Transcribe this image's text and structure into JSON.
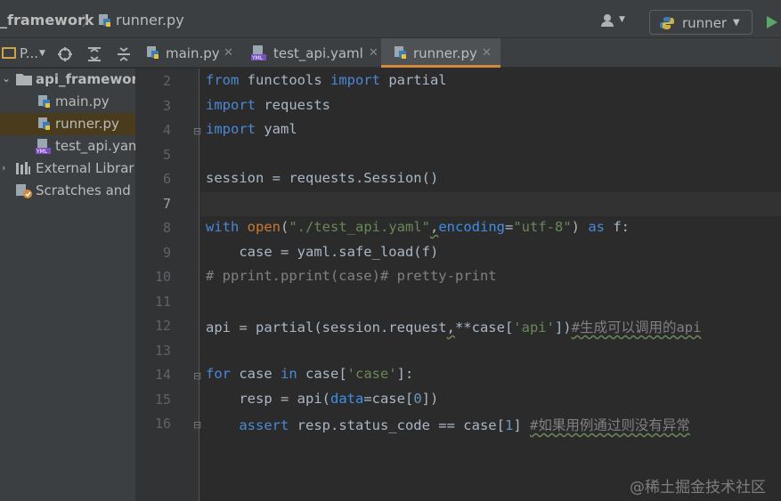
{
  "navbar": {
    "project_crumb": "_framework",
    "file_crumb": "runner.py",
    "run_config_label": "runner"
  },
  "toolstrip": {
    "project_label": "P..."
  },
  "tabs": [
    {
      "label": "main.py",
      "icon": "python-file-icon"
    },
    {
      "label": "test_api.yaml",
      "icon": "yaml-file-icon"
    },
    {
      "label": "runner.py",
      "icon": "python-file-icon",
      "active": true
    }
  ],
  "tree": {
    "items": [
      {
        "label": "api_framework",
        "type": "folder"
      },
      {
        "label": "main.py",
        "type": "python"
      },
      {
        "label": "runner.py",
        "type": "python",
        "selected": true
      },
      {
        "label": "test_api.yam",
        "type": "yaml"
      },
      {
        "label": "External Librarie",
        "type": "library"
      },
      {
        "label": "Scratches and C",
        "type": "scratches"
      }
    ]
  },
  "editor": {
    "current_line": 7,
    "line_numbers": [
      "2",
      "3",
      "4",
      "5",
      "6",
      "7",
      "8",
      "9",
      "10",
      "11",
      "12",
      "13",
      "14",
      "15",
      "16"
    ],
    "lines": [
      [
        {
          "t": "from",
          "c": "kwb"
        },
        {
          "t": " functools "
        },
        {
          "t": "import",
          "c": "kwb"
        },
        {
          "t": " partial"
        }
      ],
      [
        {
          "t": "import",
          "c": "kwb"
        },
        {
          "t": " requests"
        }
      ],
      [
        {
          "t": "import",
          "c": "kwb"
        },
        {
          "t": " yaml"
        }
      ],
      [],
      [
        {
          "t": "session = requests.Session()"
        }
      ],
      [],
      [
        {
          "t": "with",
          "c": "kwb"
        },
        {
          "t": " "
        },
        {
          "t": "open",
          "c": "kw"
        },
        {
          "t": "("
        },
        {
          "t": "\"./test_api.yaml\"",
          "c": "str"
        },
        {
          "t": ",",
          "c": "wavy"
        },
        {
          "t": "encoding",
          "c": "prm"
        },
        {
          "t": "="
        },
        {
          "t": "\"utf-8\"",
          "c": "str"
        },
        {
          "t": ") "
        },
        {
          "t": "as",
          "c": "kwb"
        },
        {
          "t": " f:"
        }
      ],
      [
        {
          "t": "    case = yaml.safe_load(f)"
        }
      ],
      [
        {
          "t": "# pprint.pprint(case)# pretty-print",
          "c": "cmt"
        }
      ],
      [],
      [
        {
          "t": "api = partial(session.request"
        },
        {
          "t": ",",
          "c": "wavy"
        },
        {
          "t": "**case["
        },
        {
          "t": "'api'",
          "c": "str"
        },
        {
          "t": "])"
        },
        {
          "t": "#生成可以调用的api",
          "c": "cmt wavy"
        }
      ],
      [],
      [
        {
          "t": "for",
          "c": "kwb"
        },
        {
          "t": " case "
        },
        {
          "t": "in",
          "c": "kwb"
        },
        {
          "t": " case["
        },
        {
          "t": "'case'",
          "c": "str"
        },
        {
          "t": "]:"
        }
      ],
      [
        {
          "t": "    resp = api("
        },
        {
          "t": "data",
          "c": "prm"
        },
        {
          "t": "=case["
        },
        {
          "t": "0",
          "c": "num"
        },
        {
          "t": "])"
        }
      ],
      [
        {
          "t": "    "
        },
        {
          "t": "assert",
          "c": "kwb"
        },
        {
          "t": " resp.status_code == case["
        },
        {
          "t": "1",
          "c": "num"
        },
        {
          "t": "] "
        },
        {
          "t": "#如果用例通过则没有异常",
          "c": "cmt wavy"
        }
      ]
    ]
  },
  "watermark": "@稀土掘金技术社区",
  "colors": {
    "editor_bg": "#2b2b2b",
    "panel_bg": "#3c3f41",
    "keyword": "#4b88d6",
    "string": "#6a8759",
    "number": "#6897bb",
    "comment": "#808080",
    "active_tab_underline": "#d08a3a",
    "run_green": "#59a869"
  }
}
